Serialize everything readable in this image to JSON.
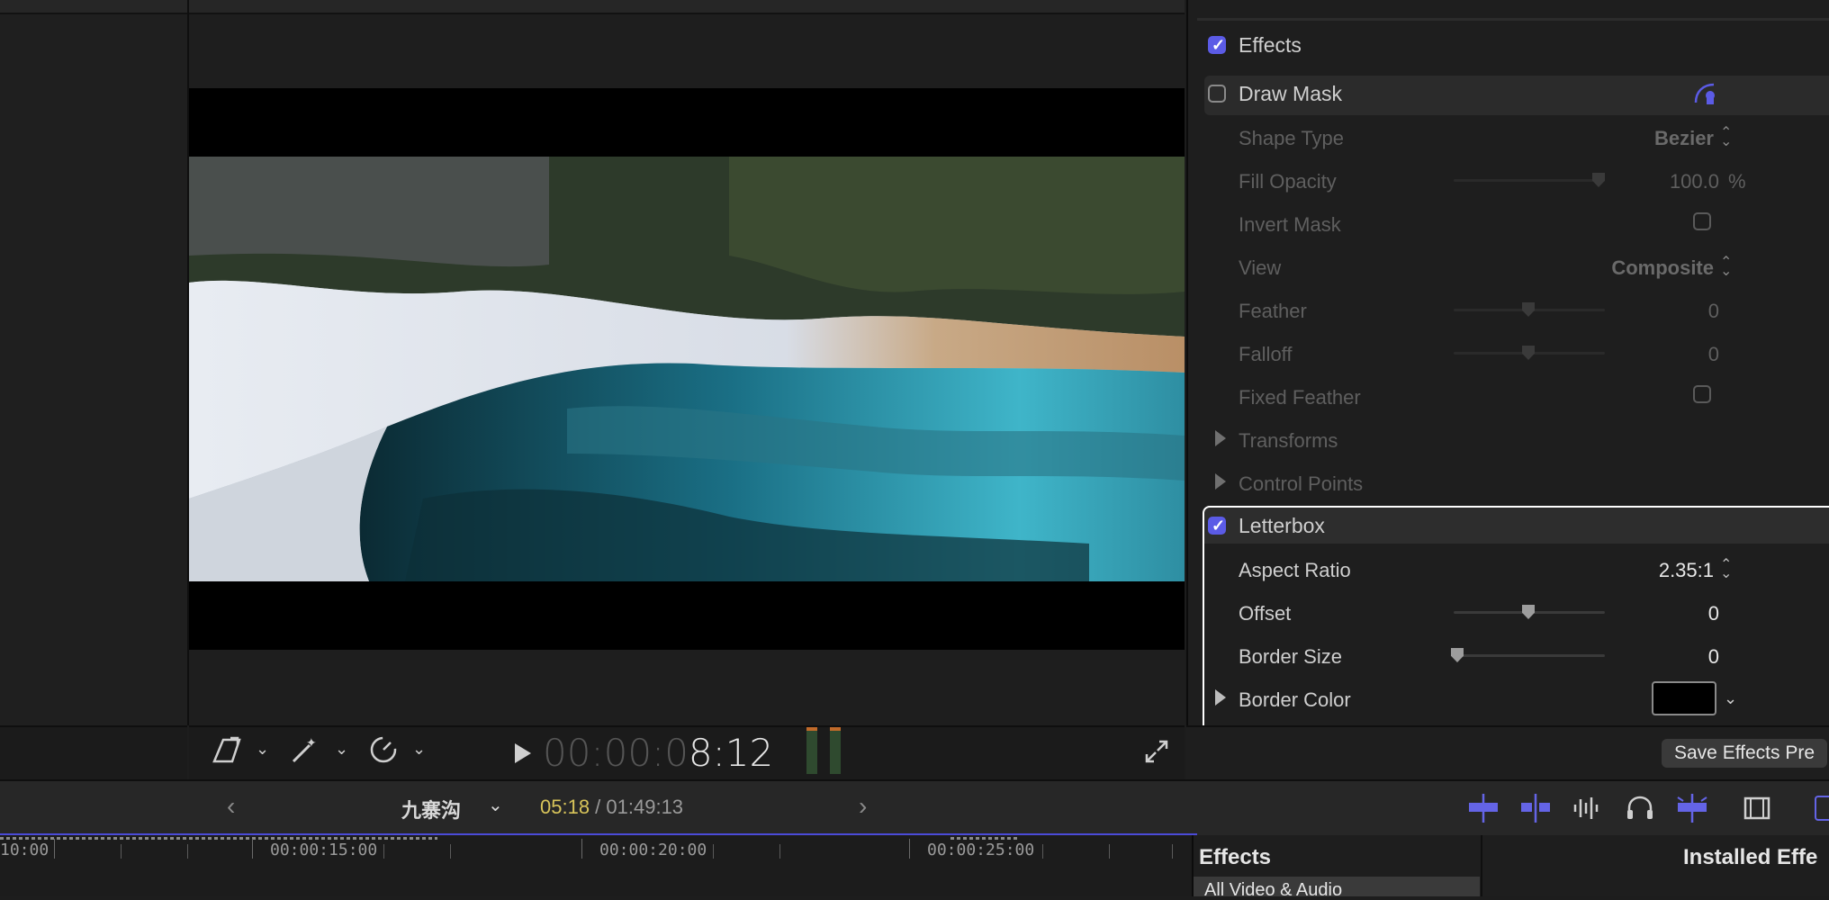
{
  "inspector": {
    "effects_section": {
      "label": "Effects",
      "checked": true
    },
    "draw_mask": {
      "label": "Draw Mask",
      "checked": false,
      "icon": "mask-tool-icon",
      "params": [
        {
          "label": "Shape Type",
          "value": "Bezier",
          "control": "popup"
        },
        {
          "label": "Fill Opacity",
          "value": "100.0",
          "unit": "%",
          "control": "slider"
        },
        {
          "label": "Invert Mask",
          "control": "checkbox",
          "checked": false
        },
        {
          "label": "View",
          "value": "Composite",
          "control": "popup"
        },
        {
          "label": "Feather",
          "value": "0",
          "control": "slider"
        },
        {
          "label": "Falloff",
          "value": "0",
          "control": "slider"
        },
        {
          "label": "Fixed Feather",
          "control": "checkbox",
          "checked": false
        }
      ],
      "groups": [
        "Transforms",
        "Control Points"
      ]
    },
    "letterbox": {
      "label": "Letterbox",
      "checked": true,
      "aspect_ratio": {
        "label": "Aspect Ratio",
        "value": "2.35:1"
      },
      "offset": {
        "label": "Offset",
        "value": "0"
      },
      "border_size": {
        "label": "Border Size",
        "value": "0"
      },
      "border_color": {
        "label": "Border Color",
        "swatch": "#000000"
      }
    },
    "save_button": "Save Effects Pre"
  },
  "viewer": {
    "timecode_dim": "00:00:0",
    "timecode_bright": "8:12",
    "toolbar_icons": [
      "transform-tool-icon",
      "enhance-wand-icon",
      "retime-speed-icon",
      "play-icon",
      "fullscreen-icon"
    ]
  },
  "timeline": {
    "project_name": "九寨沟",
    "playhead_time": "05:18",
    "separator": " / ",
    "duration": "01:49:13",
    "ruler_labels": [
      "10:00",
      "00:00:15:00",
      "00:00:20:00",
      "00:00:25:00"
    ]
  },
  "effects_browser": {
    "title": "Effects",
    "installed_label": "Installed Effe",
    "category": "All Video & Audio"
  },
  "colors": {
    "accent": "#5b5be6",
    "playhead_time": "#d8c45a"
  }
}
